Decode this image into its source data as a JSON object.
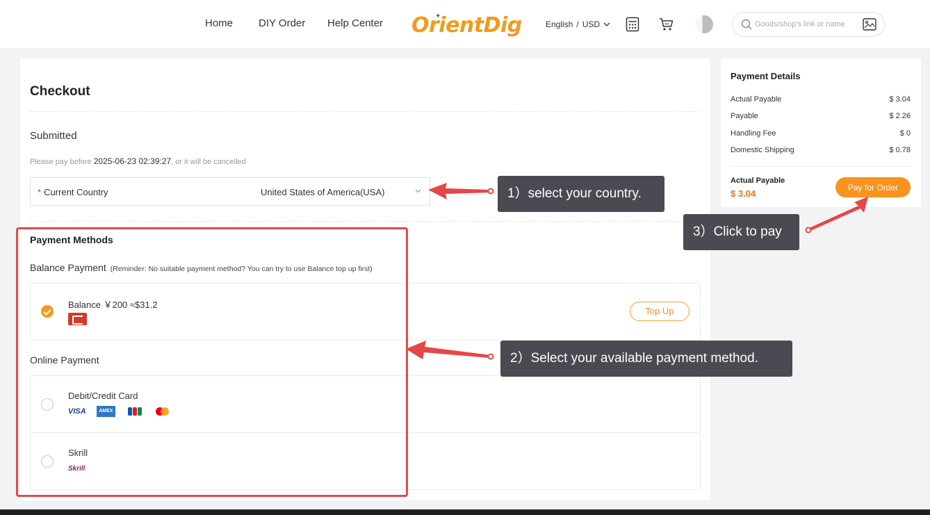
{
  "header": {
    "nav": [
      "Home",
      "DIY Order",
      "Help Center"
    ],
    "logo_text": "OrientDig",
    "language": "English",
    "currency": "USD",
    "search_placeholder": "Goods/shop's link or name",
    "icons": [
      "calculator-icon",
      "cart-icon",
      "avatar",
      "search-icon",
      "image-search-icon"
    ]
  },
  "checkout": {
    "title": "Checkout",
    "status": "Submitted",
    "deadline_prefix": "Please pay before",
    "deadline": "2025-06-23 02:39:27",
    "deadline_suffix": ", or it will be cancelled",
    "country_label": "Current Country",
    "country_value": "United States of America(USA)"
  },
  "payment": {
    "title": "Payment Methods",
    "balance_title": "Balance Payment",
    "balance_reminder": "(Reminder: No suitable payment method? You can try to use Balance top up first)",
    "balance_text": "Balance ￥200 ≈$31.2",
    "topup_label": "Top Up",
    "online_title": "Online Payment",
    "card_label": "Debit/Credit Card",
    "visa": "VISA",
    "amex": "AMEX",
    "skrill_label": "Skrill",
    "skrill_logo": "Skrill"
  },
  "details": {
    "title": "Payment Details",
    "rows": [
      {
        "label": "Actual Payable",
        "value": "$ 3.04"
      },
      {
        "label": "Payable",
        "value": "$ 2.26"
      },
      {
        "label": "Handling Fee",
        "value": "$ 0"
      },
      {
        "label": "Domestic Shipping",
        "value": "$ 0.78"
      }
    ],
    "total_label": "Actual Payable",
    "total_value": "$ 3.04",
    "pay_label": "Pay for Order"
  },
  "annotations": {
    "step1": "1）select your country.",
    "step2": "2）Select your available payment method.",
    "step3": "3）Click to pay"
  },
  "colors": {
    "accent": "#f7931e",
    "highlight": "#e24a4a",
    "tooltip_bg": "#4a4a52"
  }
}
